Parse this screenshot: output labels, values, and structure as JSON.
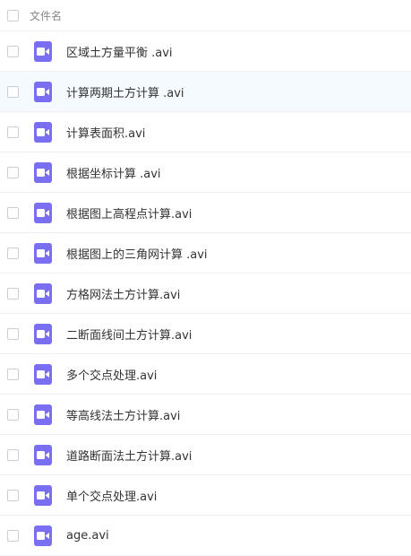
{
  "header": {
    "column_label": "文件名"
  },
  "files": [
    {
      "name": "区域土方量平衡 .avi",
      "icon": "video-file-icon"
    },
    {
      "name": "计算两期土方计算 .avi",
      "icon": "video-file-icon"
    },
    {
      "name": "计算表面积.avi",
      "icon": "video-file-icon"
    },
    {
      "name": "根据坐标计算 .avi",
      "icon": "video-file-icon"
    },
    {
      "name": "根据图上高程点计算.avi",
      "icon": "video-file-icon"
    },
    {
      "name": "根据图上的三角网计算 .avi",
      "icon": "video-file-icon"
    },
    {
      "name": "方格网法土方计算.avi",
      "icon": "video-file-icon"
    },
    {
      "name": "二断面线间土方计算.avi",
      "icon": "video-file-icon"
    },
    {
      "name": "多个交点处理.avi",
      "icon": "video-file-icon"
    },
    {
      "name": "等高线法土方计算.avi",
      "icon": "video-file-icon"
    },
    {
      "name": "道路断面法土方计算.avi",
      "icon": "video-file-icon"
    },
    {
      "name": "单个交点处理.avi",
      "icon": "video-file-icon"
    },
    {
      "name": "age.avi",
      "icon": "video-file-icon"
    }
  ],
  "colors": {
    "icon_bg": "#7a6ff0",
    "row_highlight": "#f5fafe",
    "divider": "#eef0f3"
  }
}
